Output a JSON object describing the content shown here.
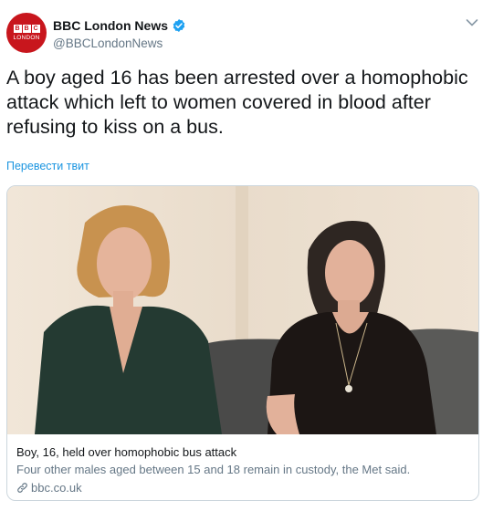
{
  "account": {
    "display_name": "BBC London News",
    "handle": "@BBCLondonNews",
    "avatar_letters": [
      "B",
      "B",
      "C"
    ],
    "avatar_caption": "LONDON",
    "verified": true
  },
  "tweet": {
    "text": "A boy aged 16 has been arrested over a homophobic attack which left to women covered in blood after refusing to kiss on a bus.",
    "translate_label": "Перевести твит"
  },
  "card": {
    "title": "Boy, 16, held over homophobic bus attack",
    "description": "Four other males aged between 15 and 18 remain in custody, the Met said.",
    "domain": "bbc.co.uk"
  },
  "icons": {
    "verified": "verified-badge-icon",
    "menu": "chevron-down-icon",
    "link": "link-icon"
  },
  "colors": {
    "brand_red": "#c8161d",
    "link_blue": "#1b95e0",
    "verified_blue": "#1da1f2",
    "secondary_text": "#657786",
    "border": "#ccd6dd"
  }
}
